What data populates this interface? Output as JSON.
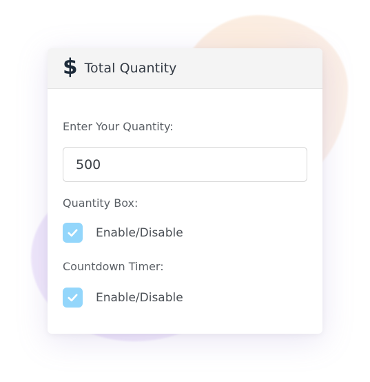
{
  "header": {
    "icon": "dollar-icon",
    "title": "Total Quantity"
  },
  "quantity": {
    "label": "Enter Your Quantity:",
    "value": "500"
  },
  "quantity_box": {
    "label": "Quantity Box:",
    "checked": true,
    "option_label": "Enable/Disable"
  },
  "countdown_timer": {
    "label": "Countdown Timer:",
    "checked": true,
    "option_label": "Enable/Disable"
  },
  "colors": {
    "checkbox_fill": "#93d6fb",
    "header_bg": "#f4f4f4",
    "icon": "#1d2b3a"
  }
}
